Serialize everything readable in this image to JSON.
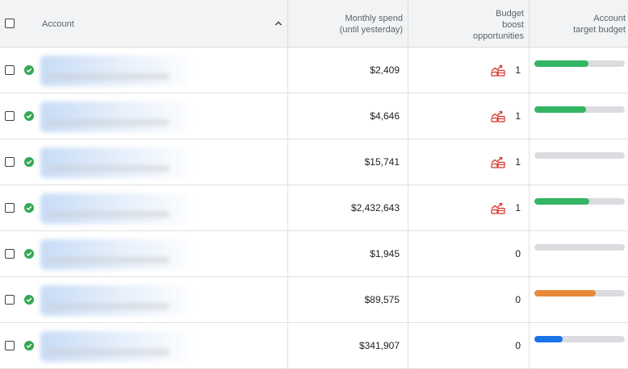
{
  "header": {
    "account_label": "Account",
    "spend_label_line1": "Monthly spend",
    "spend_label_line2": "(until yesterday)",
    "boost_label_line1": "Budget",
    "boost_label_line2": "boost",
    "boost_label_line3": "opportunities",
    "target_label_line1": "Account",
    "target_label_line2": "target budget",
    "sort_direction": "ascending"
  },
  "colors": {
    "green": "#33b563",
    "orange": "#e8893a",
    "blue": "#1a73e8",
    "boost_icon": "#d93025",
    "status_ok": "#34a853"
  },
  "rows": [
    {
      "status": "active",
      "spend": "$2,409",
      "boost_count": "1",
      "has_boost": true,
      "target_progress": 0.6,
      "target_color": "green"
    },
    {
      "status": "active",
      "spend": "$4,646",
      "boost_count": "1",
      "has_boost": true,
      "target_progress": 0.57,
      "target_color": "green"
    },
    {
      "status": "active",
      "spend": "$15,741",
      "boost_count": "1",
      "has_boost": true,
      "target_progress": 0,
      "target_color": "none"
    },
    {
      "status": "active",
      "spend": "$2,432,643",
      "boost_count": "1",
      "has_boost": true,
      "target_progress": 0.61,
      "target_color": "green"
    },
    {
      "status": "active",
      "spend": "$1,945",
      "boost_count": "0",
      "has_boost": false,
      "target_progress": 0,
      "target_color": "none"
    },
    {
      "status": "active",
      "spend": "$89,575",
      "boost_count": "0",
      "has_boost": false,
      "target_progress": 0.68,
      "target_color": "orange"
    },
    {
      "status": "active",
      "spend": "$341,907",
      "boost_count": "0",
      "has_boost": false,
      "target_progress": 0.31,
      "target_color": "blue"
    }
  ]
}
